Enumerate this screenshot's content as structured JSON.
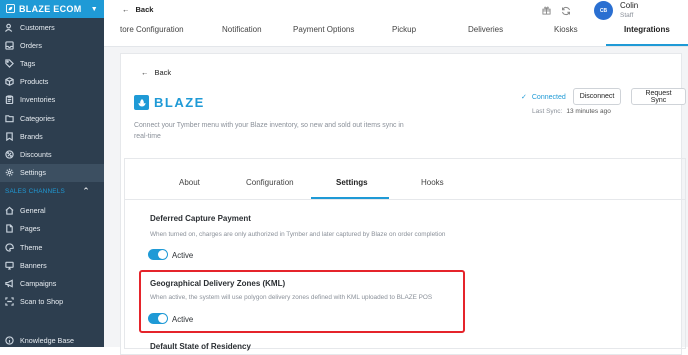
{
  "sidebar": {
    "logo": "BLAZE ECOM",
    "items": [
      {
        "label": "Customers",
        "icon": "users-icon"
      },
      {
        "label": "Orders",
        "icon": "inbox-icon"
      },
      {
        "label": "Tags",
        "icon": "tag-icon"
      },
      {
        "label": "Products",
        "icon": "box-icon"
      },
      {
        "label": "Inventories",
        "icon": "clipboard-icon"
      },
      {
        "label": "Categories",
        "icon": "folder-icon"
      },
      {
        "label": "Brands",
        "icon": "bookmark-icon"
      },
      {
        "label": "Discounts",
        "icon": "discount-icon"
      },
      {
        "label": "Settings",
        "icon": "gear-icon"
      }
    ],
    "section_label": "SALES CHANNELS",
    "channel_items": [
      {
        "label": "General",
        "icon": "home-icon"
      },
      {
        "label": "Pages",
        "icon": "page-icon"
      },
      {
        "label": "Theme",
        "icon": "palette-icon"
      },
      {
        "label": "Banners",
        "icon": "monitor-icon"
      },
      {
        "label": "Campaigns",
        "icon": "megaphone-icon"
      },
      {
        "label": "Scan to Shop",
        "icon": "scan-icon"
      }
    ],
    "bottom_item": {
      "label": "Knowledge Base",
      "icon": "info-icon"
    }
  },
  "topbar": {
    "back_label": "Back",
    "user": {
      "initials": "CB",
      "name": "Colin",
      "role": "Staff"
    },
    "tabs": [
      "tore Configuration",
      "Notification",
      "Payment Options",
      "Pickup",
      "Deliveries",
      "Kiosks",
      "Integrations"
    ],
    "active_tab": "Integrations"
  },
  "integration": {
    "back_label": "Back",
    "brand_name": "BLAZE",
    "description": "Connect your Tymber menu with your Blaze inventory, so new and sold out items sync in real-time",
    "status": "Connected",
    "last_sync_label": "Last Sync:",
    "last_sync_value": "13 minutes ago",
    "disconnect_label": "Disconnect",
    "request_sync_label": "Request Sync",
    "tabs": [
      "About",
      "Configuration",
      "Settings",
      "Hooks"
    ],
    "active_tab": "Settings",
    "settings": [
      {
        "title": "Deferred Capture Payment",
        "description": "When turned on, charges are only authorized in Tymber and later captured by Blaze on order completion",
        "toggle_label": "Active"
      },
      {
        "title": "Geographical Delivery Zones (KML)",
        "description": "When active, the system will use polygon delivery zones defined with KML uploaded to BLAZE POS",
        "toggle_label": "Active"
      },
      {
        "title": "Default State of Residency"
      }
    ]
  },
  "colors": {
    "accent": "#1f9ad6",
    "sidebar_bg": "#2d3e4f",
    "highlight": "#e5242b"
  }
}
